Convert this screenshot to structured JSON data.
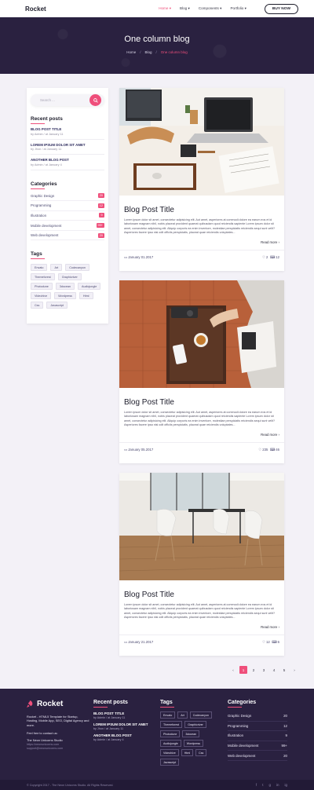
{
  "header": {
    "logo": "Rocket",
    "menu": [
      {
        "label": "Home ▾",
        "active": true
      },
      {
        "label": "Blog ▾",
        "active": false
      },
      {
        "label": "Components ▾",
        "active": false
      },
      {
        "label": "Portfolio ▾",
        "active": false
      }
    ],
    "buy_label": "BUY NOW"
  },
  "hero": {
    "title": "One column blog",
    "breadcrumb": [
      "Home",
      "Blog",
      "One column blog"
    ],
    "separator": "/"
  },
  "sidebar": {
    "search_placeholder": "Search ...",
    "recent_title": "Recent posts",
    "recent": [
      {
        "title": "BLOG POST TITLE",
        "meta": "by Admin / at January 11"
      },
      {
        "title": "LOREM IPSUM DOLOR SIT AMET",
        "meta": "by Jhon / at January 11"
      },
      {
        "title": "ANOTHER BLOG POST",
        "meta": "by Admin / at January 4"
      }
    ],
    "categories_title": "Categories",
    "categories": [
      {
        "label": "Graphic Design",
        "count": "20"
      },
      {
        "label": "Programming",
        "count": "12"
      },
      {
        "label": "Illustration",
        "count": "9"
      },
      {
        "label": "Mobile development",
        "count": "99+"
      },
      {
        "label": "Web development",
        "count": "20"
      }
    ],
    "tags_title": "Tags",
    "tags": [
      "Envato",
      "Art",
      "Codecanyon",
      "Themeforest",
      "Graphicriver",
      "Photodune",
      "3docean",
      "Audiojungle",
      "Videohive",
      "Wordpress",
      "Html",
      "Css",
      "Javascript"
    ]
  },
  "posts": [
    {
      "title": "Blog Post Title",
      "body": "Lorem ipsum dolor sit amet, consectetur adipisicing elit. Aut amet, asperiores at commodi dolore ea earum eos et id laboriosam magnam nihil, nobis placeat provident quaerat quibusdam quod reiciendis sapiente Lorem ipsum dolor sit amet, consectetur adipisicing elit. Aliquip corporis ea enim inventore, molestiae perspiciatis reiciendis sequi sunt velit? Asperiores facere ipsa nisi odit officiis perspiciatis, placeat quae reiciendis voluptates...",
      "more": "Read more",
      "date": "January 01.2017",
      "likes": "2",
      "comments": "12"
    },
    {
      "title": "Blog Post Title",
      "body": "Lorem ipsum dolor sit amet, consectetur adipisicing elit. Aut amet, asperiores at commodi dolore ea earum eos et id laboriosam magnam nihil, nobis placeat provident quaerat quibusdam quod reiciendis sapiente Lorem ipsum dolor sit amet, consectetur adipisicing elit. Aliquip corporis ea enim inventore, molestiae perspiciatis reiciendis sequi sunt velit? Asperiores facere ipsa nisi odit officiis perspiciatis, placeat quae reiciendis voluptates...",
      "more": "Read more",
      "date": "January 05.2017",
      "likes": "235",
      "comments": "46"
    },
    {
      "title": "Blog Post Title",
      "body": "Lorem ipsum dolor sit amet, consectetur adipisicing elit. Aut amet, asperiores at commodi dolore ea earum eos et id laboriosam magnam nihil, nobis placeat provident quaerat quibusdam quod reiciendis sapiente Lorem ipsum dolor sit amet, consectetur adipisicing elit. Aliquip corporis ea enim inventore, molestiae perspiciatis reiciendis sequi sunt velit? Asperiores facere ipsa nisi odit officiis perspiciatis, placeat quae reiciendis voluptates...",
      "more": "Read more",
      "date": "January 21.2017",
      "likes": "12",
      "comments": "6"
    }
  ],
  "pagination": {
    "prev": "‹",
    "pages": [
      "1",
      "2",
      "3",
      "4",
      "5"
    ],
    "next": "›",
    "current": "1"
  },
  "footer": {
    "logo": "Rocket",
    "about": "Rocket - HTML5 Template for Startup, Hosting, Mobile App, SEO, Digital Agency and more.",
    "contact_title": "Feel free to contact us:",
    "company": "The Neon Unicorns Studio",
    "site": "https://neonunicorns.com",
    "email": "support@neonunicorns.com",
    "recent_title": "Recent posts",
    "recent": [
      {
        "title": "BLOG POST TITLE",
        "meta": "by Admin / at January 11"
      },
      {
        "title": "LOREM IPSUM DOLOR SIT AMET",
        "meta": "by Jhon / at January 11"
      },
      {
        "title": "ANOTHER BLOG POST",
        "meta": "by Admin / at January 4"
      }
    ],
    "tags_title": "Tags",
    "tags": [
      "Envato",
      "Art",
      "Codecanyon",
      "Themeforest",
      "Graphicriver",
      "Photodune",
      "3docean",
      "Audiojungle",
      "Wordpress",
      "Videohive",
      "Html",
      "Css",
      "Javascript"
    ],
    "categories_title": "Categories",
    "categories": [
      {
        "label": "Graphic Design",
        "count": "20"
      },
      {
        "label": "Programming",
        "count": "12"
      },
      {
        "label": "Illustration",
        "count": "9"
      },
      {
        "label": "Mobile development",
        "count": "99+"
      },
      {
        "label": "Web development",
        "count": "20"
      }
    ],
    "copyright": "© Copyright 2017 - The Neon Unicorns Studio. All Rights Reserved.",
    "social": [
      "f",
      "t",
      "g",
      "in",
      "ig"
    ]
  },
  "colors": {
    "accent": "#ef4f7b",
    "dark": "#2a2140"
  }
}
